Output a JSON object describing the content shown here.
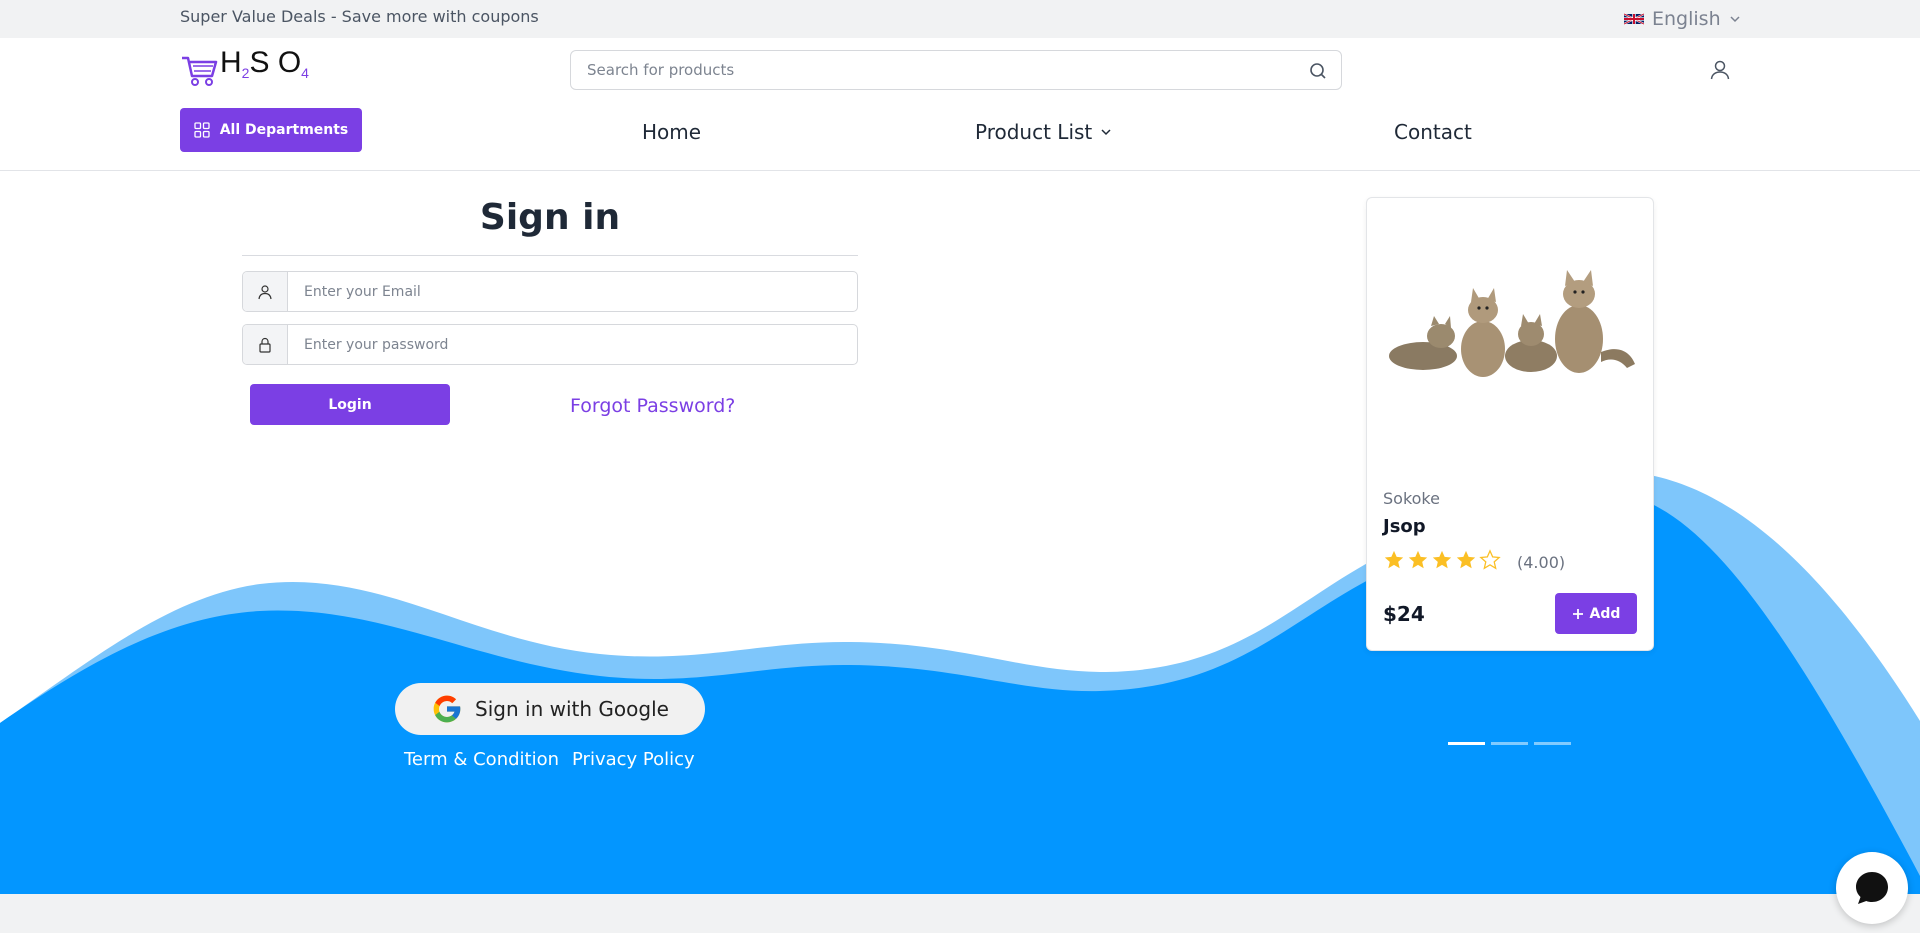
{
  "topbar": {
    "promo": "Super Value Deals - Save more with coupons",
    "language": "English"
  },
  "header": {
    "logo": {
      "h": "H",
      "sub1": "2",
      "s": "S",
      "o": "O",
      "sub2": "4"
    },
    "search_placeholder": "Search for products",
    "departments_label": "All Departments",
    "nav": {
      "home": "Home",
      "products": "Product List",
      "contact": "Contact"
    }
  },
  "signin": {
    "title": "Sign in",
    "email_placeholder": "Enter your Email",
    "password_placeholder": "Enter your password",
    "login_label": "Login",
    "forgot_label": "Forgot Password?",
    "google_label": "Sign in with Google",
    "terms_label": "Term & Condition",
    "privacy_label": "Privacy Policy"
  },
  "product": {
    "brand": "Sokoke",
    "name": "Jsop",
    "rating": 4,
    "rating_text": "(4.00)",
    "price": "$24",
    "add_label": "Add"
  },
  "carousel": {
    "slides": 3,
    "active": 0
  },
  "colors": {
    "accent": "#7b3fe4",
    "wave": "#0396ff",
    "wave_light": "#7ec6fb",
    "star": "#fbbf24"
  }
}
